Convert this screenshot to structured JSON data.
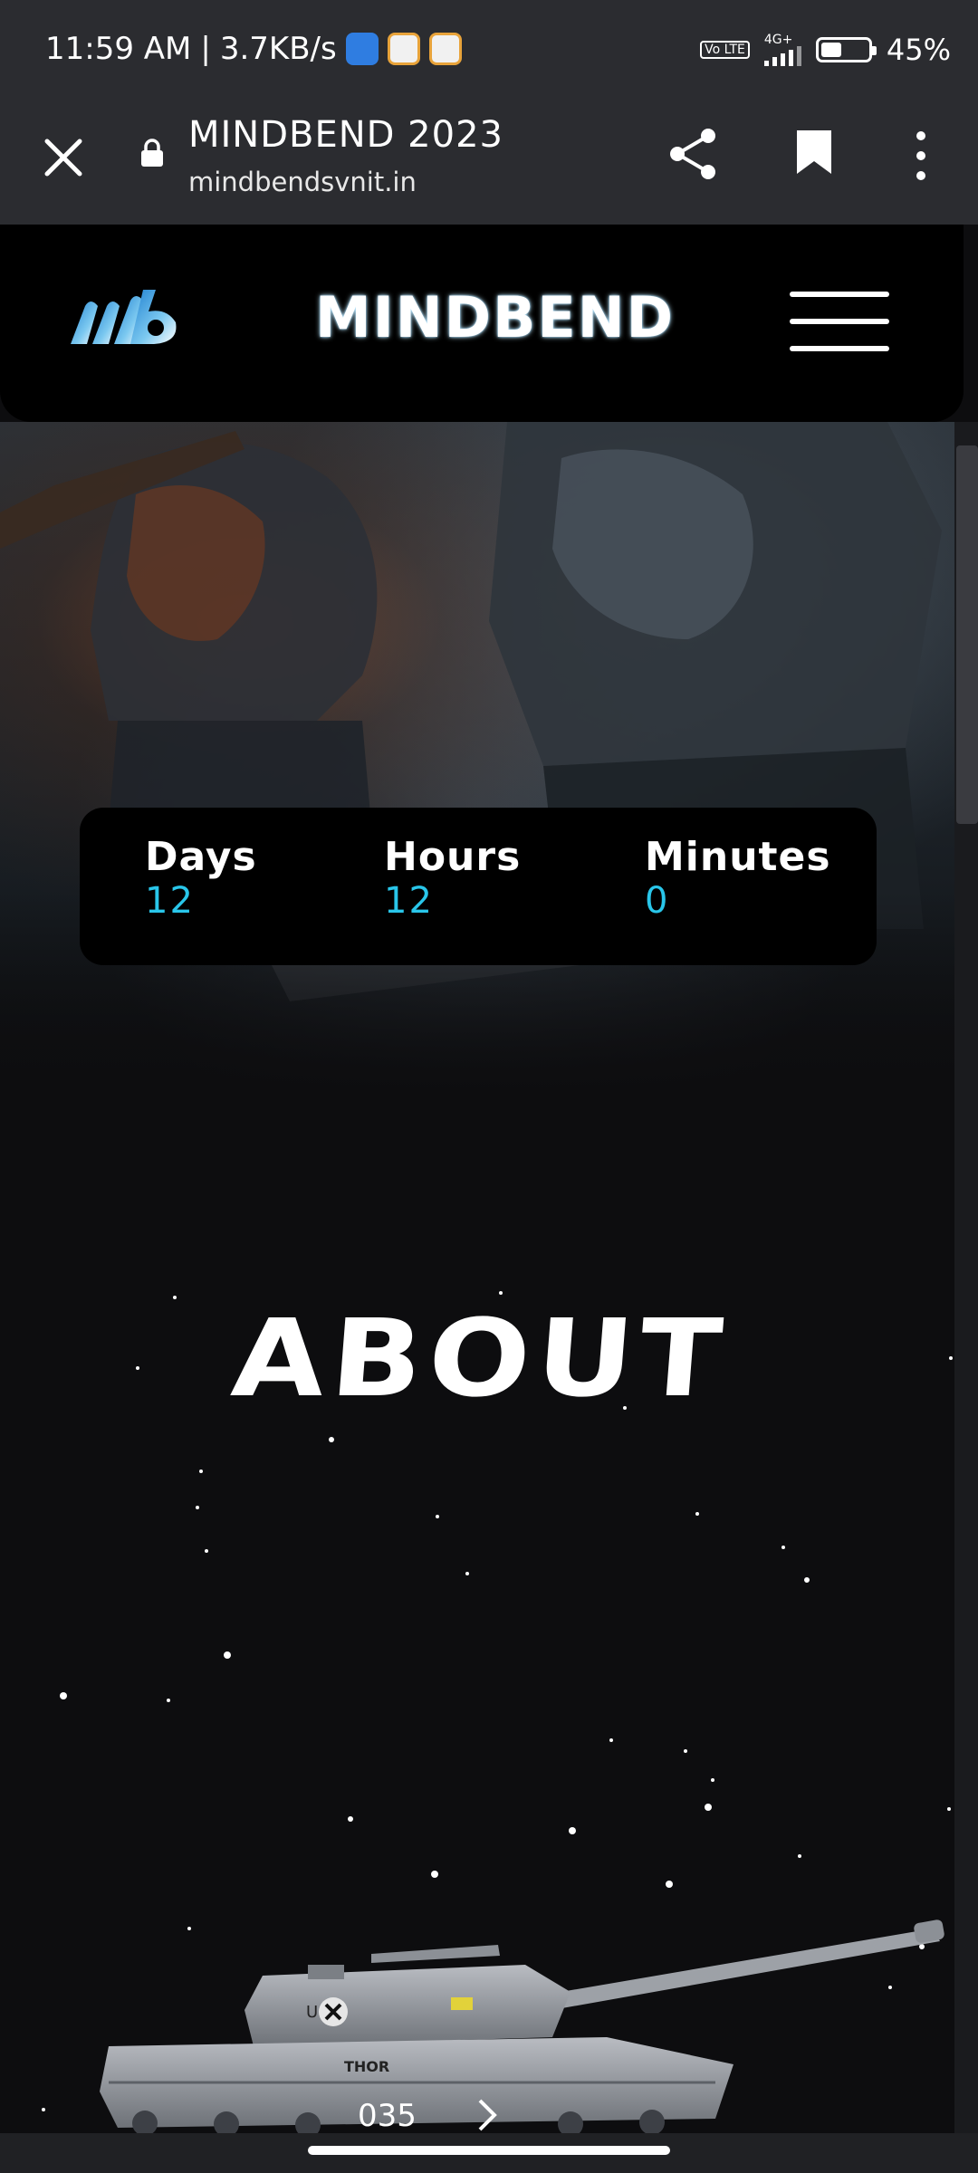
{
  "status_bar": {
    "time": "11:59 AM",
    "speed": "3.7KB/s",
    "network_type": "4G+",
    "volte": "Vo LTE",
    "battery_percent": "45%",
    "battery_level": 0.45,
    "icons": [
      "phone-notification-icon",
      "app-notification-icon",
      "app-notification-icon",
      "volte-icon",
      "signal-icon",
      "battery-icon"
    ]
  },
  "browser": {
    "title": "MINDBEND 2023",
    "url": "mindbendsvnit.in",
    "icons": [
      "close-icon",
      "lock-icon",
      "share-icon",
      "bookmark-icon",
      "more-options-icon"
    ]
  },
  "header": {
    "logo_text": "mb",
    "brand": "MINDBEND",
    "menu_icon": "hamburger-icon"
  },
  "countdown": {
    "days_label": "Days",
    "days_value": "12",
    "hours_label": "Hours",
    "hours_value": "12",
    "minutes_label": "Minutes",
    "minutes_value": "0"
  },
  "about": {
    "heading": "ABOUT"
  },
  "tank": {
    "turret_text": "U",
    "hull_text": "THOR",
    "number": "035"
  },
  "colors": {
    "accent": "#29c6ea",
    "background": "#0d0d0f",
    "browser_bar": "#2b2c30"
  }
}
